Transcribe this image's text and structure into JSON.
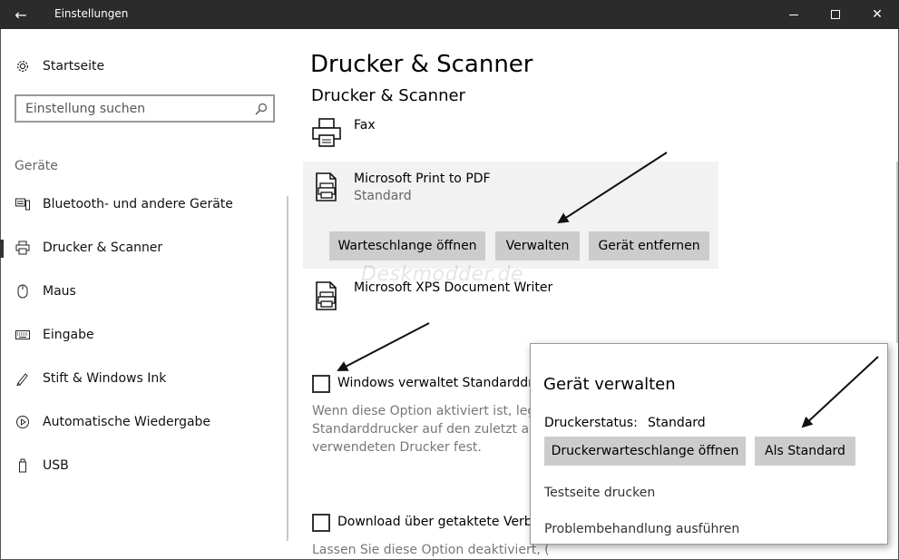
{
  "window": {
    "title": "Einstellungen",
    "back_glyph": "←",
    "close_glyph": "✕"
  },
  "sidebar": {
    "home_label": "Startseite",
    "search_placeholder": "Einstellung suchen",
    "section_title": "Geräte",
    "items": [
      {
        "label": "Bluetooth- und andere Geräte",
        "icon": "keyboard-devices-icon"
      },
      {
        "label": "Drucker & Scanner",
        "icon": "printer-icon",
        "active": true
      },
      {
        "label": "Maus",
        "icon": "mouse-icon"
      },
      {
        "label": "Eingabe",
        "icon": "keyboard-icon"
      },
      {
        "label": "Stift & Windows Ink",
        "icon": "pen-icon"
      },
      {
        "label": "Automatische Wiedergabe",
        "icon": "autoplay-icon"
      },
      {
        "label": "USB",
        "icon": "usb-icon"
      }
    ]
  },
  "main": {
    "page_title": "Drucker & Scanner",
    "section_title": "Drucker & Scanner",
    "printers": [
      {
        "name": "Fax",
        "status": ""
      },
      {
        "name": "Microsoft Print to PDF",
        "status": "Standard"
      },
      {
        "name": "Microsoft XPS Document Writer",
        "status": ""
      }
    ],
    "actions": {
      "queue": "Warteschlange öffnen",
      "manage": "Verwalten",
      "remove": "Gerät entfernen"
    },
    "option_default": {
      "label": "Windows verwaltet Standarddru",
      "desc_lines": [
        "Wenn diese Option aktiviert ist, legt",
        "Standarddrucker auf den zuletzt an l",
        "verwendeten Drucker fest."
      ],
      "checked": false
    },
    "option_download": {
      "label": "Download über getaktete Verbin",
      "desc_lines": [
        "Lassen Sie diese Option deaktiviert, ("
      ],
      "checked": false
    }
  },
  "popup": {
    "title": "Gerät verwalten",
    "status_label": "Druckerstatus:",
    "status_value": "Standard",
    "open_queue": "Druckerwarteschlange öffnen",
    "set_default": "Als Standard",
    "test_page": "Testseite drucken",
    "troubleshoot": "Problembehandlung ausführen"
  },
  "watermark": "Deskmodder.de"
}
